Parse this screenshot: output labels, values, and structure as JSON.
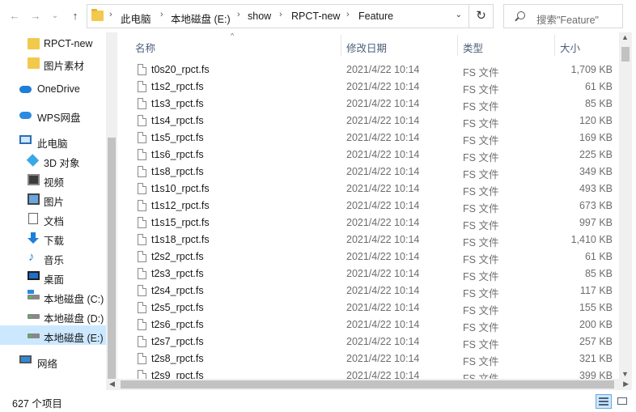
{
  "nav_buttons": {
    "back": "←",
    "forward": "→",
    "recent": "⌄",
    "up": "↑"
  },
  "breadcrumbs": [
    "此电脑",
    "本地磁盘 (E:)",
    "show",
    "RPCT-new",
    "Feature"
  ],
  "refresh_icon": "↻",
  "search": {
    "placeholder": "搜索\"Feature\""
  },
  "sidebar": {
    "items": [
      {
        "label": "RPCT-new",
        "icon": "folder-icon"
      },
      {
        "label": "图片素材",
        "icon": "folder-icon"
      },
      {
        "label": "OneDrive",
        "icon": "onedrive-cloud-icon"
      },
      {
        "label": "WPS网盘",
        "icon": "wps-cloud-icon"
      },
      {
        "label": "此电脑",
        "icon": "this-pc-icon"
      },
      {
        "label": "3D 对象",
        "icon": "3d-objects-icon"
      },
      {
        "label": "视频",
        "icon": "video-icon"
      },
      {
        "label": "图片",
        "icon": "pictures-icon"
      },
      {
        "label": "文档",
        "icon": "documents-icon"
      },
      {
        "label": "下载",
        "icon": "download-icon"
      },
      {
        "label": "音乐",
        "icon": "music-icon"
      },
      {
        "label": "桌面",
        "icon": "desktop-icon"
      },
      {
        "label": "本地磁盘 (C:)",
        "icon": "drive-c-icon"
      },
      {
        "label": "本地磁盘 (D:)",
        "icon": "drive-icon"
      },
      {
        "label": "本地磁盘 (E:)",
        "icon": "drive-icon",
        "selected": true
      },
      {
        "label": "网络",
        "icon": "network-icon"
      }
    ]
  },
  "columns": {
    "name": "名称",
    "date": "修改日期",
    "type": "类型",
    "size": "大小"
  },
  "files": [
    {
      "name": "t0s20_rpct.fs",
      "date": "2021/4/22 10:14",
      "type": "FS 文件",
      "size": "1,709 KB"
    },
    {
      "name": "t1s2_rpct.fs",
      "date": "2021/4/22 10:14",
      "type": "FS 文件",
      "size": "61 KB"
    },
    {
      "name": "t1s3_rpct.fs",
      "date": "2021/4/22 10:14",
      "type": "FS 文件",
      "size": "85 KB"
    },
    {
      "name": "t1s4_rpct.fs",
      "date": "2021/4/22 10:14",
      "type": "FS 文件",
      "size": "120 KB"
    },
    {
      "name": "t1s5_rpct.fs",
      "date": "2021/4/22 10:14",
      "type": "FS 文件",
      "size": "169 KB"
    },
    {
      "name": "t1s6_rpct.fs",
      "date": "2021/4/22 10:14",
      "type": "FS 文件",
      "size": "225 KB"
    },
    {
      "name": "t1s8_rpct.fs",
      "date": "2021/4/22 10:14",
      "type": "FS 文件",
      "size": "349 KB"
    },
    {
      "name": "t1s10_rpct.fs",
      "date": "2021/4/22 10:14",
      "type": "FS 文件",
      "size": "493 KB"
    },
    {
      "name": "t1s12_rpct.fs",
      "date": "2021/4/22 10:14",
      "type": "FS 文件",
      "size": "673 KB"
    },
    {
      "name": "t1s15_rpct.fs",
      "date": "2021/4/22 10:14",
      "type": "FS 文件",
      "size": "997 KB"
    },
    {
      "name": "t1s18_rpct.fs",
      "date": "2021/4/22 10:14",
      "type": "FS 文件",
      "size": "1,410 KB"
    },
    {
      "name": "t2s2_rpct.fs",
      "date": "2021/4/22 10:14",
      "type": "FS 文件",
      "size": "61 KB"
    },
    {
      "name": "t2s3_rpct.fs",
      "date": "2021/4/22 10:14",
      "type": "FS 文件",
      "size": "85 KB"
    },
    {
      "name": "t2s4_rpct.fs",
      "date": "2021/4/22 10:14",
      "type": "FS 文件",
      "size": "117 KB"
    },
    {
      "name": "t2s5_rpct.fs",
      "date": "2021/4/22 10:14",
      "type": "FS 文件",
      "size": "155 KB"
    },
    {
      "name": "t2s6_rpct.fs",
      "date": "2021/4/22 10:14",
      "type": "FS 文件",
      "size": "200 KB"
    },
    {
      "name": "t2s7_rpct.fs",
      "date": "2021/4/22 10:14",
      "type": "FS 文件",
      "size": "257 KB"
    },
    {
      "name": "t2s8_rpct.fs",
      "date": "2021/4/22 10:14",
      "type": "FS 文件",
      "size": "321 KB"
    },
    {
      "name": "t2s9_rpct.fs",
      "date": "2021/4/22 10:14",
      "type": "FS 文件",
      "size": "399 KB"
    }
  ],
  "status": {
    "item_count": "627 个项目"
  },
  "colors": {
    "selection": "#cce8ff",
    "header_text": "#4c607a",
    "folder": "#f2c94c",
    "accent": "#1e7fd8"
  }
}
